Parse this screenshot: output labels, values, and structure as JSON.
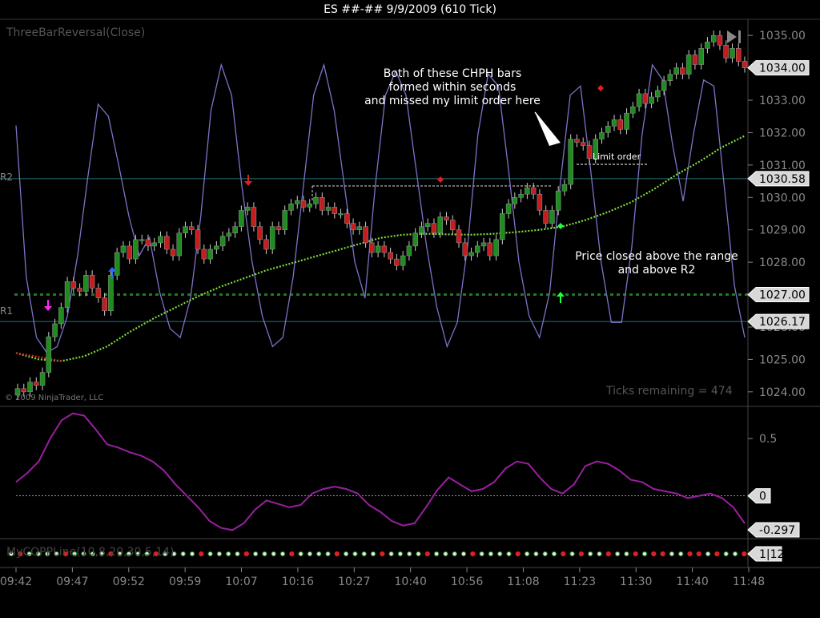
{
  "title": "ES ##-##  9/9/2009 (610 Tick)",
  "indicator_label": "ThreeBarReversal(Close)",
  "copyright": "© 2009 NinjaTrader, LLC",
  "ticks_remaining": "Ticks remaining = 474",
  "annotations": {
    "bars_note": [
      "Both of these CHPH bars",
      "formed within seconds",
      "and missed my limit order here"
    ],
    "limit_order": "Limit order",
    "price_note": [
      "Price closed above the range",
      "and above R2"
    ],
    "r2": "R2",
    "r1": "R1",
    "lower_label": "MyCOPPLine(10,8,20,30,5,14)"
  },
  "colors": {
    "up_bar": "#1e8c1e",
    "down_bar": "#c21e1e",
    "oscillator": "#7a74c8",
    "ma": "#7fe03c",
    "ma_dn": "#d62b2b",
    "momentum": "#9a1fa0",
    "level_line": "#2a6f78",
    "r_dotted": "#1e7a1e"
  },
  "chart_data": [
    {
      "type": "candlestick",
      "title": "ES ##-##  9/9/2009 (610 Tick)",
      "y_axis_ticks": [
        1024.0,
        1025.0,
        1026.0,
        1027.0,
        1028.0,
        1029.0,
        1030.0,
        1031.0,
        1032.0,
        1033.0,
        1034.0,
        1035.0
      ],
      "ylim": [
        1023.6,
        1035.4
      ],
      "price_labels": [
        {
          "value": 1034.0,
          "text": "1034.00"
        },
        {
          "value": 1030.58,
          "text": "1030.58"
        },
        {
          "value": 1027.0,
          "text": "1027.00"
        },
        {
          "value": 1026.17,
          "text": "1026.17"
        }
      ],
      "levels": {
        "R2": 1030.58,
        "R1": 1026.17,
        "dotted": 1027.0
      },
      "x_axis_ticks": [
        "09:42",
        "09:47",
        "09:52",
        "09:59",
        "10:07",
        "10:16",
        "10:27",
        "10:40",
        "10:56",
        "11:08",
        "11:23",
        "11:30",
        "11:40",
        "11:48"
      ],
      "closes": [
        1024.1,
        1024.0,
        1024.3,
        1024.2,
        1024.6,
        1025.7,
        1026.1,
        1026.6,
        1027.4,
        1027.2,
        1027.1,
        1027.6,
        1027.2,
        1026.9,
        1026.5,
        1027.6,
        1028.3,
        1028.5,
        1028.1,
        1028.7,
        1028.7,
        1028.5,
        1028.6,
        1028.8,
        1028.4,
        1028.2,
        1028.9,
        1029.1,
        1029.0,
        1028.4,
        1028.1,
        1028.4,
        1028.5,
        1028.8,
        1028.9,
        1029.1,
        1029.6,
        1029.7,
        1029.1,
        1028.7,
        1028.4,
        1029.1,
        1029.0,
        1029.6,
        1029.8,
        1029.9,
        1029.7,
        1029.8,
        1030.0,
        1029.6,
        1029.7,
        1029.5,
        1029.5,
        1029.2,
        1029.0,
        1029.1,
        1028.6,
        1028.3,
        1028.5,
        1028.3,
        1028.1,
        1027.9,
        1028.2,
        1028.5,
        1028.9,
        1029.1,
        1029.2,
        1028.9,
        1029.4,
        1029.3,
        1029.0,
        1028.6,
        1028.2,
        1028.3,
        1028.5,
        1028.6,
        1028.2,
        1028.7,
        1029.5,
        1029.8,
        1030.0,
        1030.1,
        1030.3,
        1030.1,
        1029.6,
        1029.2,
        1029.6,
        1030.2,
        1030.4,
        1031.8,
        1031.7,
        1031.6,
        1031.2,
        1031.8,
        1032.0,
        1032.2,
        1032.4,
        1032.1,
        1032.6,
        1032.8,
        1033.2,
        1032.9,
        1033.1,
        1033.3,
        1033.6,
        1033.8,
        1034.0,
        1033.8,
        1034.4,
        1034.1,
        1034.6,
        1034.8,
        1035.0,
        1034.7,
        1034.3,
        1034.6,
        1034.2,
        1034.0
      ],
      "oscillator": [
        0.75,
        0.25,
        0.05,
        0.0,
        0.02,
        0.12,
        0.32,
        0.58,
        0.82,
        0.78,
        0.62,
        0.45,
        0.32,
        0.38,
        0.2,
        0.08,
        0.05,
        0.18,
        0.45,
        0.8,
        0.95,
        0.85,
        0.55,
        0.3,
        0.12,
        0.02,
        0.05,
        0.25,
        0.55,
        0.85,
        0.95,
        0.8,
        0.55,
        0.3,
        0.18,
        0.55,
        0.85,
        0.93,
        0.85,
        0.6,
        0.35,
        0.15,
        0.02,
        0.1,
        0.35,
        0.72,
        0.92,
        0.88,
        0.6,
        0.3,
        0.12,
        0.05,
        0.2,
        0.55,
        0.85,
        0.88,
        0.6,
        0.3,
        0.1,
        0.1,
        0.35,
        0.72,
        0.95,
        0.9,
        0.68,
        0.5,
        0.72,
        0.9,
        0.88,
        0.55,
        0.22,
        0.05
      ],
      "moving_average": [
        1025.2,
        1025.0,
        1024.95,
        1025.1,
        1025.4,
        1025.85,
        1026.25,
        1026.6,
        1026.95,
        1027.25,
        1027.5,
        1027.75,
        1027.95,
        1028.15,
        1028.35,
        1028.55,
        1028.75,
        1028.85,
        1028.88,
        1028.86,
        1028.85,
        1028.88,
        1028.93,
        1029.0,
        1029.1,
        1029.3,
        1029.55,
        1029.85,
        1030.25,
        1030.7,
        1031.1,
        1031.55,
        1031.9
      ]
    },
    {
      "type": "line",
      "y_axis_ticks": [
        0.5
      ],
      "ylim": [
        -0.36,
        0.76
      ],
      "zero_label": "0",
      "last_label": "-0.297",
      "values": [
        0.12,
        0.2,
        0.3,
        0.5,
        0.66,
        0.72,
        0.7,
        0.58,
        0.45,
        0.42,
        0.38,
        0.35,
        0.3,
        0.22,
        0.1,
        0.0,
        -0.1,
        -0.22,
        -0.28,
        -0.3,
        -0.24,
        -0.12,
        -0.04,
        -0.07,
        -0.1,
        -0.08,
        0.02,
        0.06,
        0.08,
        0.06,
        0.02,
        -0.08,
        -0.14,
        -0.22,
        -0.26,
        -0.24,
        -0.1,
        0.05,
        0.16,
        0.1,
        0.04,
        0.06,
        0.12,
        0.24,
        0.3,
        0.28,
        0.16,
        0.06,
        0.02,
        0.1,
        0.26,
        0.3,
        0.28,
        0.22,
        0.14,
        0.12,
        0.06,
        0.04,
        0.02,
        -0.02,
        0.0,
        0.02,
        -0.02,
        -0.1,
        -0.24
      ]
    },
    {
      "type": "dots",
      "label": "1|12"
    }
  ]
}
